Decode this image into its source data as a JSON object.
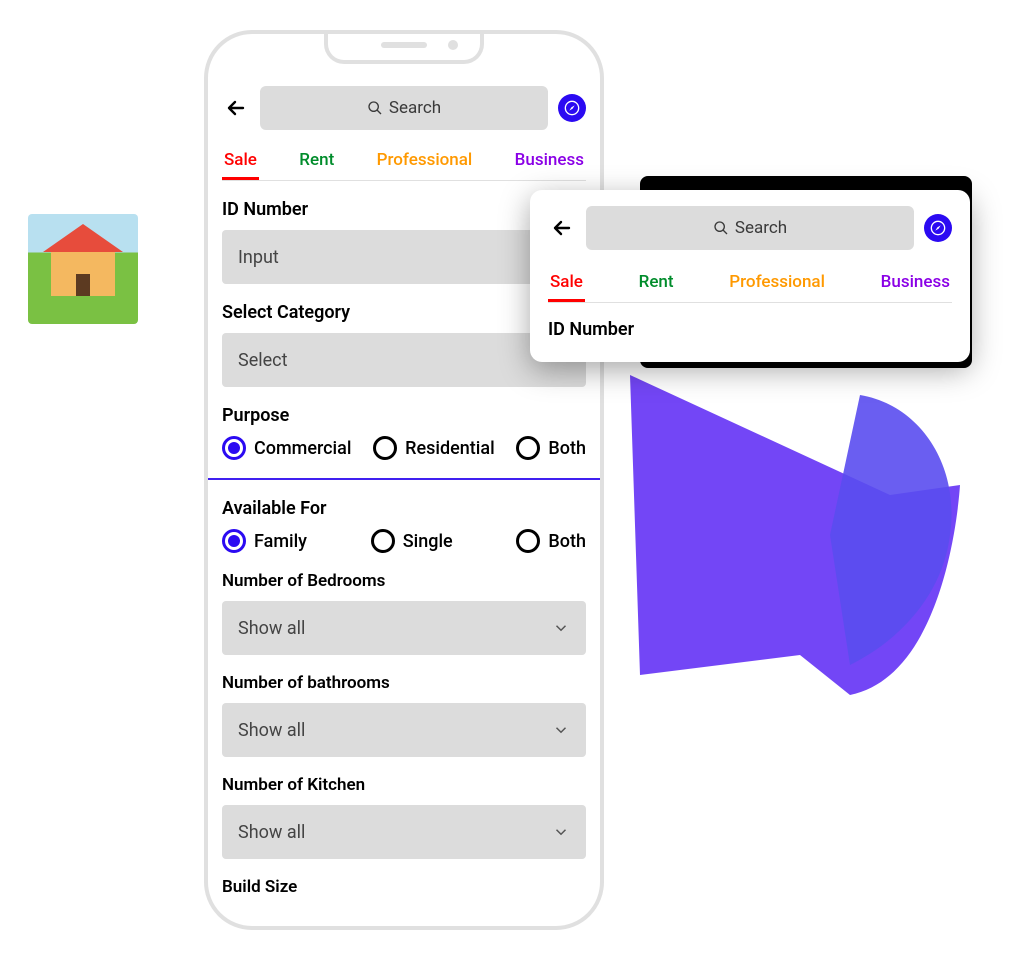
{
  "search": {
    "placeholder": "Search"
  },
  "tabs": {
    "sale": {
      "label": "Sale",
      "color": "#ff0000"
    },
    "rent": {
      "label": "Rent",
      "color": "#008c2b"
    },
    "professional": {
      "label": "Professional",
      "color": "#ff9900"
    },
    "business": {
      "label": "Business",
      "color": "#8a00e6"
    }
  },
  "form": {
    "id_number": {
      "label": "ID Number",
      "placeholder": "Input"
    },
    "category": {
      "label": "Select Category",
      "placeholder": "Select"
    },
    "purpose": {
      "label": "Purpose",
      "options": {
        "commercial": "Commercial",
        "residential": "Residential",
        "both": "Both"
      },
      "selected": "commercial"
    },
    "available_for": {
      "label": "Available For",
      "options": {
        "family": "Family",
        "single": "Single",
        "both": "Both"
      },
      "selected": "family"
    },
    "bedrooms": {
      "label": "Number of Bedrooms",
      "value": "Show all"
    },
    "bathrooms": {
      "label": "Number of bathrooms",
      "value": "Show all"
    },
    "kitchen": {
      "label": "Number of Kitchen",
      "value": "Show all"
    },
    "build_size": {
      "label": "Build Size"
    }
  },
  "callout": {
    "id_number_label": "ID Number"
  }
}
